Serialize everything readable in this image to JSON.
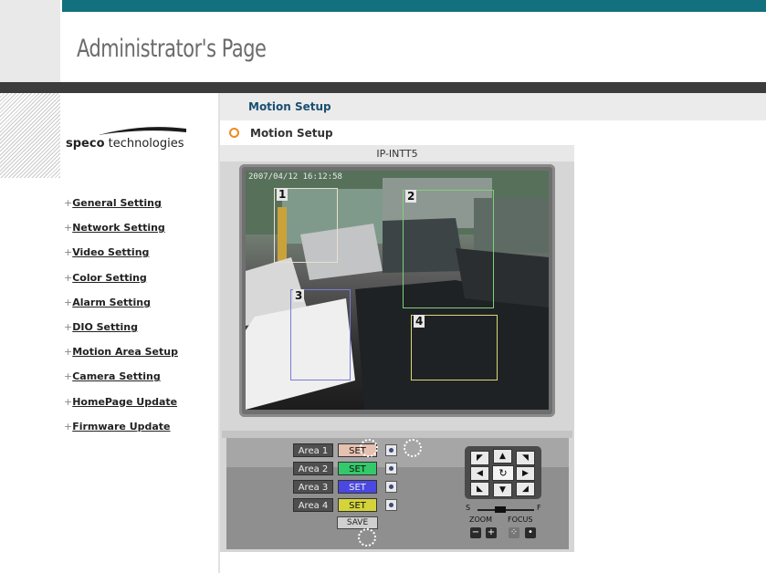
{
  "header": {
    "title": "Administrator's Page"
  },
  "brand": {
    "logo_bold": "speco",
    "logo_rest": " technologies"
  },
  "subheader": {
    "title": "Motion Setup"
  },
  "section": {
    "title": "Motion Setup"
  },
  "sidebar": {
    "items": [
      {
        "plus": "+",
        "label": "General Setting"
      },
      {
        "plus": "+",
        "label": "Network Setting"
      },
      {
        "plus": "+",
        "label": "Video Setting"
      },
      {
        "plus": "+",
        "label": "Color Setting"
      },
      {
        "plus": "+",
        "label": "Alarm Setting"
      },
      {
        "plus": "+",
        "label": "DIO Setting"
      },
      {
        "plus": "+",
        "label": "Motion Area Setup"
      },
      {
        "plus": "+",
        "label": "Camera Setting"
      },
      {
        "plus": "+",
        "label": "HomePage Update"
      },
      {
        "plus": "+",
        "label": "Firmware Update"
      }
    ]
  },
  "camera": {
    "model": "IP-INTT5",
    "timestamp": "2007/04/12 16:12:58",
    "areas": [
      {
        "number": "1",
        "color": "#e8e0d0"
      },
      {
        "number": "2",
        "color": "#7ecf7e"
      },
      {
        "number": "3",
        "color": "#7a7ad8"
      },
      {
        "number": "4",
        "color": "#d8d87a"
      }
    ]
  },
  "area_controls": [
    {
      "label": "Area 1",
      "set_label": "SET",
      "set_color": "#e6c0b0"
    },
    {
      "label": "Area 2",
      "set_label": "SET",
      "set_color": "#33c96a"
    },
    {
      "label": "Area 3",
      "set_label": "SET",
      "set_color": "#4a48e0"
    },
    {
      "label": "Area 4",
      "set_label": "SET",
      "set_color": "#d4d43a"
    }
  ],
  "save_label": "SAVE",
  "ptz": {
    "speed_min_label": "S",
    "speed_max_label": "F",
    "zoom_label": "ZOOM",
    "focus_label": "FOCUS",
    "zoom_out": "−",
    "zoom_in": "+",
    "focus_near": "⁘",
    "focus_far": "•"
  },
  "colors": {
    "accent": "#13707e",
    "bullet": "#ef8a1e",
    "link": "#1a4f72"
  }
}
